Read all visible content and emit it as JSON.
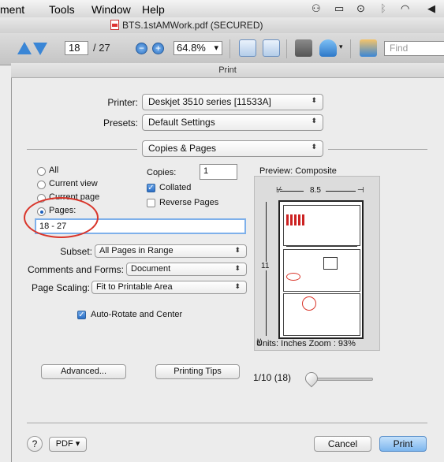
{
  "menubar": {
    "items": [
      "ment",
      "Tools",
      "Window",
      "Help"
    ]
  },
  "window": {
    "title": "BTS.1stAMWork.pdf (SECURED)"
  },
  "toolbar": {
    "page_value": "18",
    "page_total": "/ 27",
    "zoom_value": "64.8%",
    "zoom_caret": "▾",
    "find_placeholder": "Find"
  },
  "dialog": {
    "title": "Print",
    "printer_label": "Printer:",
    "printer_value": "Deskjet 3510 series [11533A]",
    "presets_label": "Presets:",
    "presets_value": "Default Settings",
    "section_value": "Copies & Pages",
    "caret": "⬍",
    "range": {
      "options": [
        "All",
        "Current view",
        "Current page",
        "Pages:"
      ],
      "selected": "Pages:",
      "pages_value": "18 - 27"
    },
    "copies_label": "Copies:",
    "copies_value": "1",
    "collated_label": "Collated",
    "reverse_label": "Reverse Pages",
    "subset_label": "Subset:",
    "subset_value": "All Pages in Range",
    "comments_label": "Comments and Forms:",
    "comments_value": "Document",
    "scaling_label": "Page Scaling:",
    "scaling_value": "Fit to Printable Area",
    "autorotate_label": "Auto-Rotate and Center",
    "preview_label": "Preview: Composite",
    "preview_width": "8.5",
    "preview_height": "11",
    "units_text": "Units: Inches Zoom :  93%",
    "advanced_label": "Advanced...",
    "tips_label": "Printing Tips",
    "page_counter": "1/10 (18)",
    "help_label": "?",
    "pdf_label": "PDF ▾",
    "cancel_label": "Cancel",
    "print_label": "Print"
  }
}
